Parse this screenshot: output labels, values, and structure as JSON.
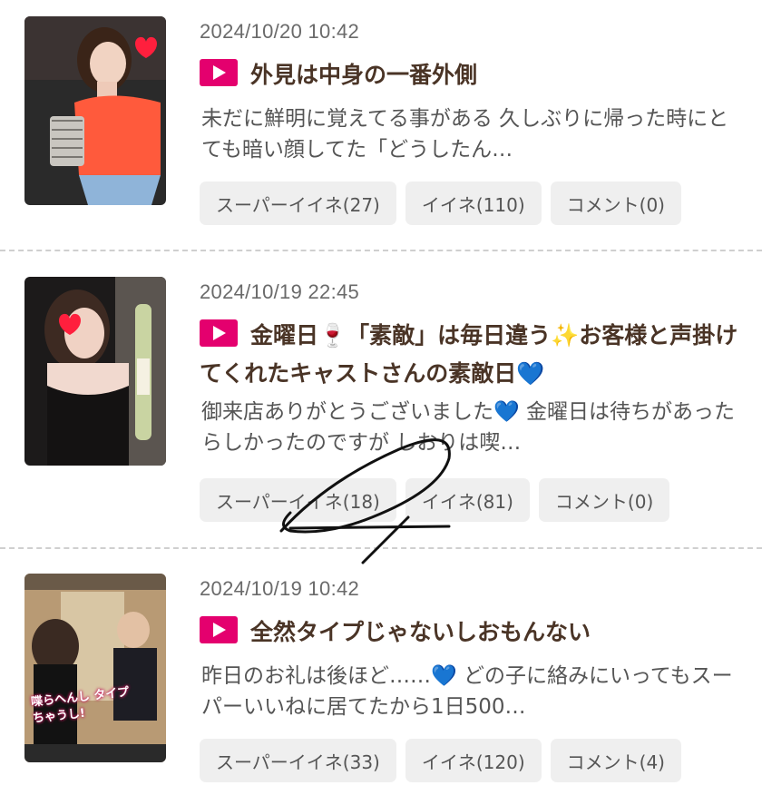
{
  "posts": [
    {
      "date": "2024/10/20 10:42",
      "title": "外見は中身の一番外側",
      "excerpt": "未だに鮮明に覚えてる事がある 久しぶりに帰った時にとても暗い顔してた「どうしたん…",
      "buttons": {
        "super_like": "スーパーイイネ(27)",
        "like": "イイネ(110)",
        "comment": "コメント(0)"
      }
    },
    {
      "date": "2024/10/19 22:45",
      "title": "金曜日🍷「素敵」は毎日違う✨お客様と声掛けてくれたキャストさんの素敵日💙",
      "excerpt": "御来店ありがとうございました💙 金曜日は待ちがあったらしかったのですが しおりは喫…",
      "buttons": {
        "super_like": "スーパーイイネ(18)",
        "like": "イイネ(81)",
        "comment": "コメント(0)"
      }
    },
    {
      "date": "2024/10/19 10:42",
      "title": "全然タイプじゃないしおもんない",
      "excerpt": "昨日のお礼は後ほど……💙 どの子に絡みにいってもスーパーいいねに居てたから1日500…",
      "buttons": {
        "super_like": "スーパーイイネ(33)",
        "like": "イイネ(120)",
        "comment": "コメント(4)"
      },
      "thumb_caption": "喋らへんし タイプちゃうし!"
    }
  ],
  "colors": {
    "play_icon": "#e4006e",
    "title": "#4a3426",
    "button_bg": "#efefef"
  }
}
